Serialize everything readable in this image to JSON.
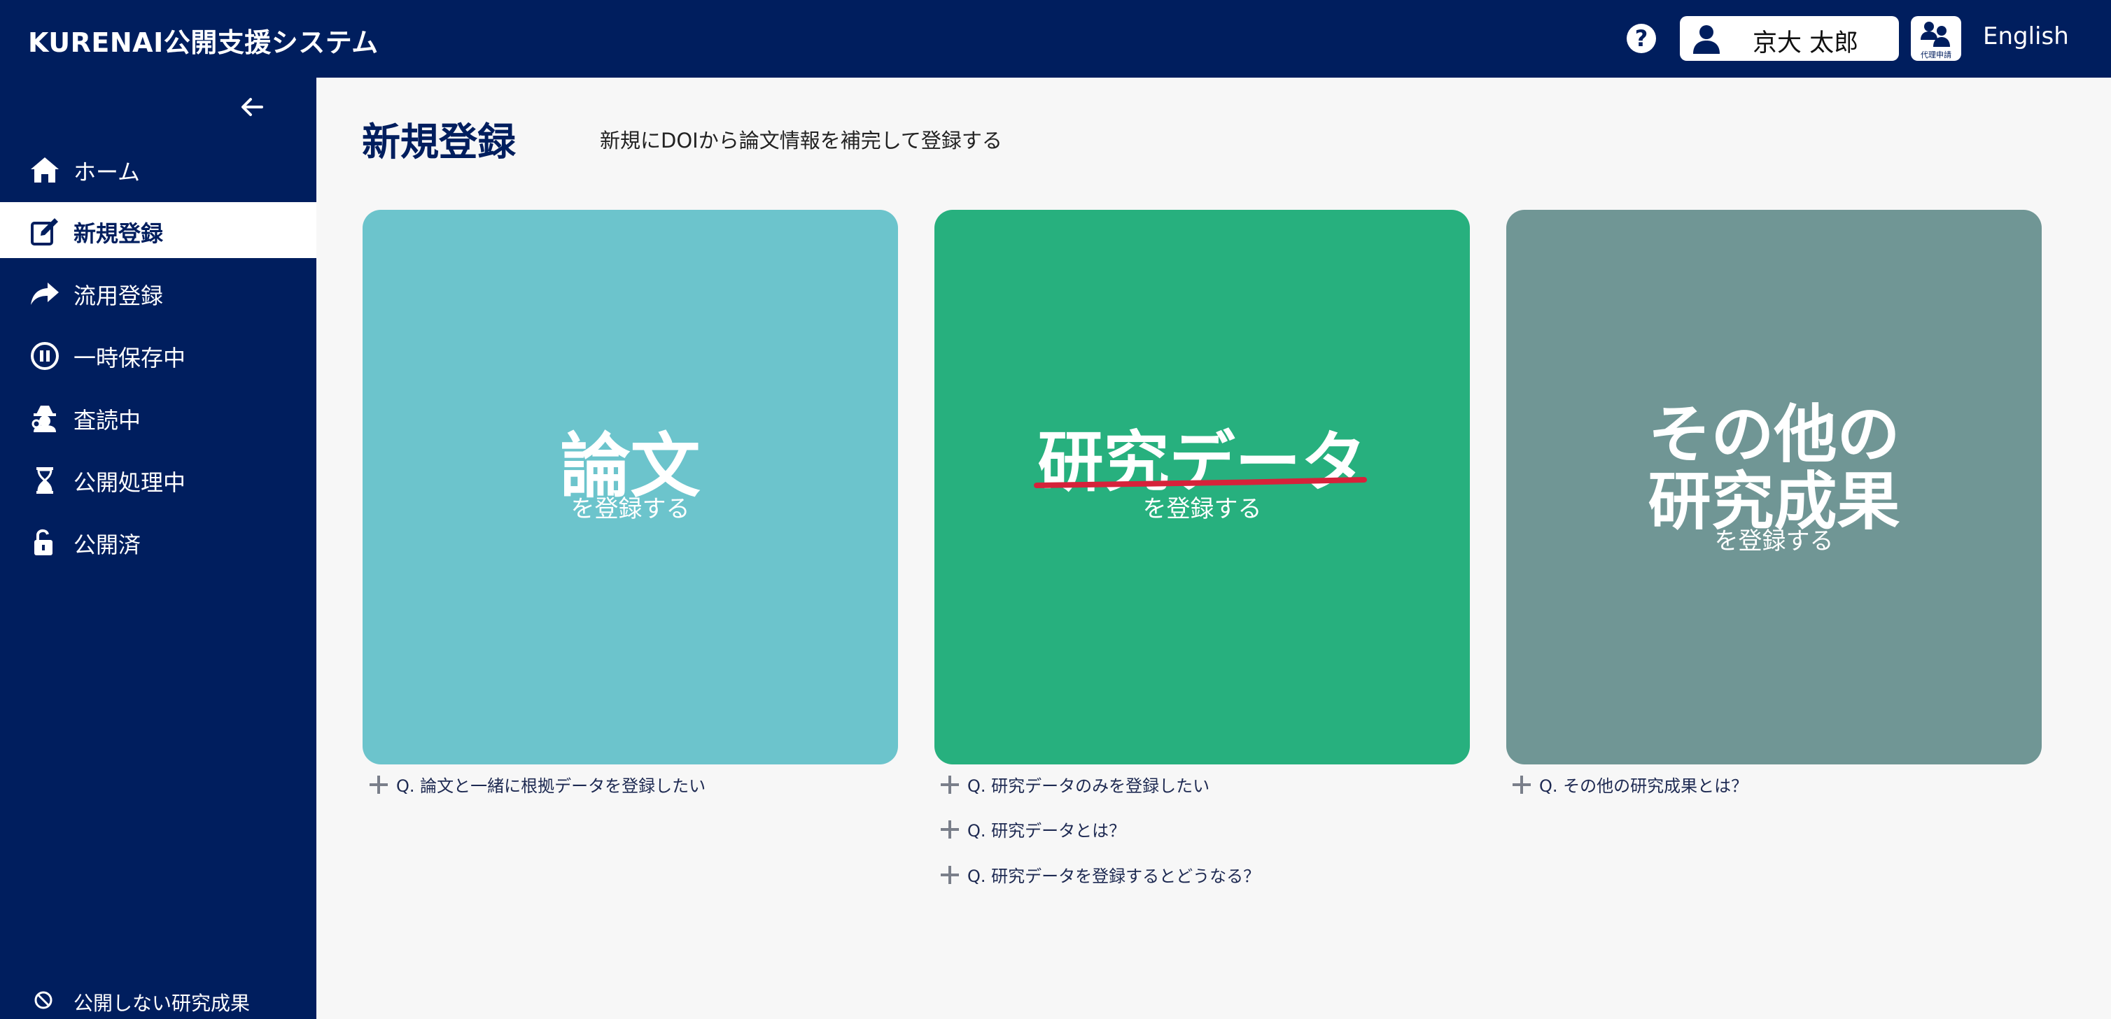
{
  "header": {
    "brand": "KURENAI公開支援システム",
    "help_label": "?",
    "user_name": "京大 太郎",
    "proxy_label": "代理申請",
    "language_label": "English"
  },
  "sidebar": {
    "items": [
      {
        "label": "ホーム",
        "icon": "home-icon"
      },
      {
        "label": "新規登録",
        "icon": "edit-icon",
        "active": true
      },
      {
        "label": "流用登録",
        "icon": "share-arrow-icon"
      },
      {
        "label": "一時保存中",
        "icon": "pause-icon"
      },
      {
        "label": "査読中",
        "icon": "detective-icon"
      },
      {
        "label": "公開処理中",
        "icon": "hourglass-icon"
      },
      {
        "label": "公開済",
        "icon": "unlock-icon"
      }
    ],
    "bottom_item": {
      "label": "公開しない研究成果",
      "icon": "ban-icon"
    }
  },
  "main": {
    "title": "新規登録",
    "description": "新規にDOIから論文情報を補完して登録する",
    "cards": [
      {
        "title": "論文",
        "subtitle": "を登録する",
        "color": "#6cc4cc"
      },
      {
        "title": "研究データ",
        "subtitle": "を登録する",
        "color": "#27b07e"
      },
      {
        "title_line1": "その他の",
        "title_line2": "研究成果",
        "subtitle": "を登録する",
        "color": "#709695"
      }
    ],
    "faqs": {
      "paper": [
        "Q. 論文と一緒に根拠データを登録したい"
      ],
      "data": [
        "Q. 研究データのみを登録したい",
        "Q. 研究データとは？",
        "Q. 研究データを登録するとどうなる？"
      ],
      "other": [
        "Q. その他の研究成果とは？"
      ]
    }
  },
  "colors": {
    "navy": "#001e5e",
    "annotation_underline": "#d6223a"
  }
}
